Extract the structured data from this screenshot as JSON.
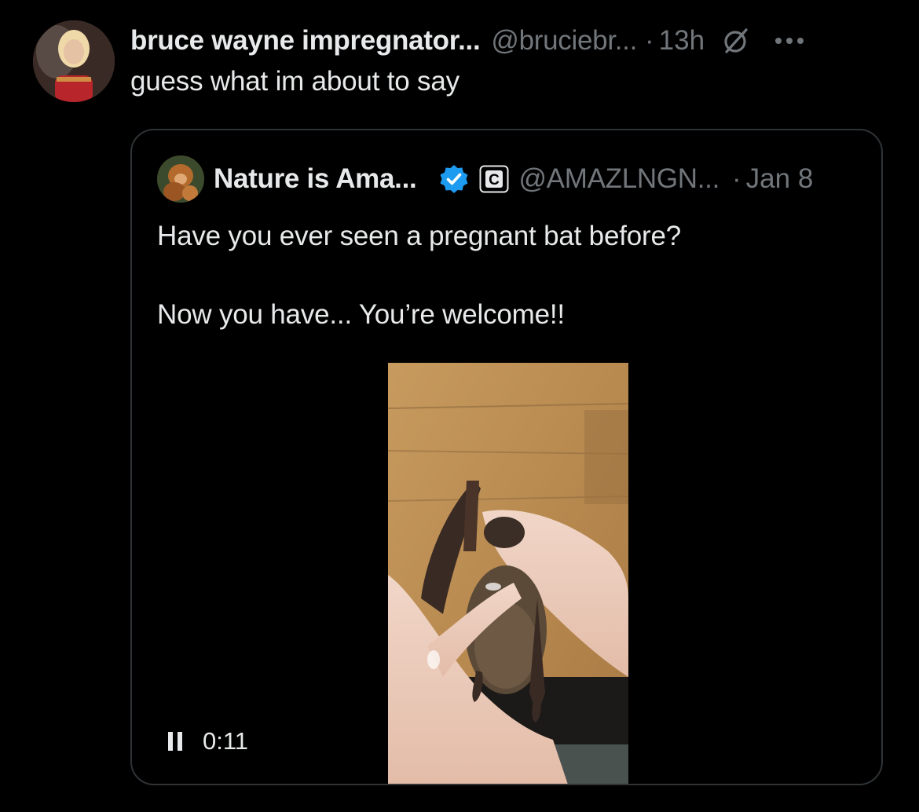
{
  "post": {
    "display_name": "bruce wayne impregnator...",
    "handle": "@bruciebr...",
    "separator": "·",
    "time": "13h",
    "text": "guess what im about to say",
    "icons": {
      "avatar": "profile-photo",
      "grok": "grok-icon",
      "more": "more-options-icon"
    }
  },
  "quoted_post": {
    "display_name": "Nature is Ama...",
    "handle": "@AMAZLNGN...",
    "separator": "·",
    "time": "Jan 8",
    "affiliate_badge_letter": "C",
    "text_lines": [
      "Have you ever seen a pregnant bat before?",
      "Now you have... You’re welcome!!"
    ],
    "video": {
      "state": "playing",
      "duration_label": "0:11"
    },
    "icons": {
      "verified": "verified-badge-icon",
      "pause": "pause-icon"
    }
  },
  "colors": {
    "background": "#000000",
    "text_primary": "#e7e9ea",
    "text_secondary": "#71767b",
    "border": "#2f3336",
    "verified_blue": "#1d9bf0"
  }
}
